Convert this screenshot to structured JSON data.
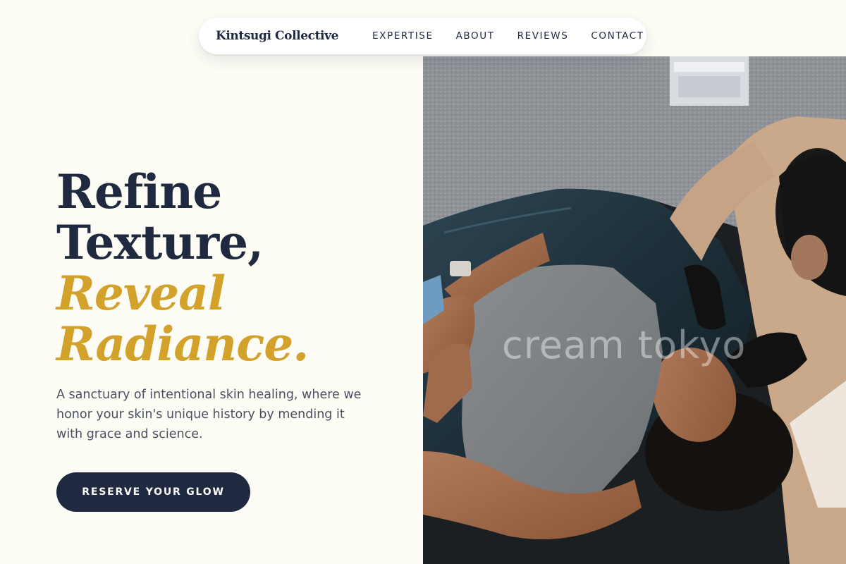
{
  "nav": {
    "brand": "Kintsugi Collective",
    "links": [
      "EXPERTISE",
      "ABOUT",
      "REVIEWS",
      "CONTACT"
    ]
  },
  "hero": {
    "headline_line1": "Refine",
    "headline_line2": "Texture,",
    "headline_accent_line1": "Reveal",
    "headline_accent_line2": "Radiance.",
    "lead": "A sanctuary of intentional skin healing, where we honor your skin's unique history by mending it with grace and science.",
    "cta_label": "RESERVE YOUR GLOW",
    "photo_watermark": "cream tokyo",
    "photo_alt": "Esthetician in black gloves treating the face of a woman lying on a treatment table"
  },
  "colors": {
    "background": "#fdfcf5",
    "navy": "#1f2a40",
    "gold": "#d2a22b",
    "body_text": "#4a5060"
  }
}
